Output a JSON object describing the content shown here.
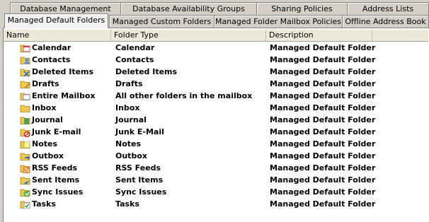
{
  "tabs_back": [
    "Database Management",
    "Database Availability Groups",
    "Sharing Policies",
    "Address Lists"
  ],
  "tabs_front": [
    "Managed Default Folders",
    "Managed Custom Folders",
    "Managed Folder Mailbox Policies",
    "Offline Address Book"
  ],
  "active_tab": "Managed Default Folders",
  "columns": [
    "Name",
    "Folder Type",
    "Description"
  ],
  "rows": [
    {
      "name": "Calendar",
      "type": "Calendar",
      "desc": "Managed Default Folder",
      "icon": "calendar-icon"
    },
    {
      "name": "Contacts",
      "type": "Contacts",
      "desc": "Managed Default Folder",
      "icon": "contacts-icon"
    },
    {
      "name": "Deleted Items",
      "type": "Deleted Items",
      "desc": "Managed Default Folder",
      "icon": "deleted-items-icon"
    },
    {
      "name": "Drafts",
      "type": "Drafts",
      "desc": "Managed Default Folder",
      "icon": "drafts-icon"
    },
    {
      "name": "Entire Mailbox",
      "type": "All other folders in the mailbox",
      "desc": "Managed Default Folder",
      "icon": "entire-mailbox-icon"
    },
    {
      "name": "Inbox",
      "type": "Inbox",
      "desc": "Managed Default Folder",
      "icon": "inbox-icon"
    },
    {
      "name": "Journal",
      "type": "Journal",
      "desc": "Managed Default Folder",
      "icon": "journal-icon"
    },
    {
      "name": "Junk E-mail",
      "type": "Junk E-Mail",
      "desc": "Managed Default Folder",
      "icon": "junk-email-icon"
    },
    {
      "name": "Notes",
      "type": "Notes",
      "desc": "Managed Default Folder",
      "icon": "notes-icon"
    },
    {
      "name": "Outbox",
      "type": "Outbox",
      "desc": "Managed Default Folder",
      "icon": "outbox-icon"
    },
    {
      "name": "RSS Feeds",
      "type": "RSS Feeds",
      "desc": "Managed Default Folder",
      "icon": "rss-feeds-icon"
    },
    {
      "name": "Sent Items",
      "type": "Sent Items",
      "desc": "Managed Default Folder",
      "icon": "sent-items-icon"
    },
    {
      "name": "Sync Issues",
      "type": "Sync Issues",
      "desc": "Managed Default Folder",
      "icon": "sync-issues-icon"
    },
    {
      "name": "Tasks",
      "type": "Tasks",
      "desc": "Managed Default Folder",
      "icon": "tasks-icon"
    }
  ],
  "colors": {
    "panel_bg": "#ffffff",
    "chrome_bg": "#d4d0c8",
    "header_bg": "#ece9d8",
    "folder_yellow": "#f0c850"
  }
}
